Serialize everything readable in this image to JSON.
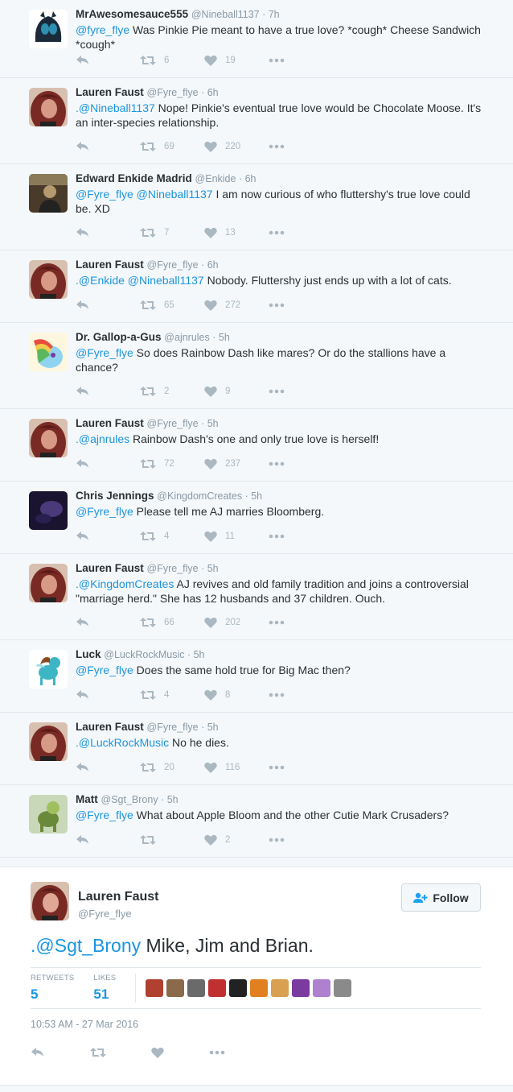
{
  "thread": [
    {
      "name": "MrAwesomesauce555",
      "handle": "@Nineball1137",
      "time": "7h",
      "mentions": "@fyre_flye",
      "text": " Was Pinkie Pie meant to have a true love? *cough* Cheese Sandwich *cough*",
      "retweets": "6",
      "likes": "19",
      "avatar_icon": "changeling-avatar",
      "avatar_colors": [
        "#1a2a3a",
        "#2e8fb0"
      ]
    },
    {
      "name": "Lauren Faust",
      "handle": "@Fyre_flye",
      "time": "6h",
      "mentions": ".@Nineball1137",
      "text": " Nope! Pinkie's eventual true love would be Chocolate Moose. It's an inter-species relationship.",
      "retweets": "69",
      "likes": "220",
      "avatar_icon": "lauren-avatar",
      "avatar_colors": [
        "#7a2a24",
        "#d69a86"
      ]
    },
    {
      "name": "Edward Enkide Madrid",
      "handle": "@Enkide",
      "time": "6h",
      "mentions": "@Fyre_flye @Nineball1137",
      "text": " I am now curious of who fluttershy's true love could be. XD",
      "retweets": "7",
      "likes": "13",
      "avatar_icon": "edward-avatar",
      "avatar_colors": [
        "#4a3a2a",
        "#b59a70"
      ]
    },
    {
      "name": "Lauren Faust",
      "handle": "@Fyre_flye",
      "time": "6h",
      "mentions": ".@Enkide @Nineball1137",
      "text": " Nobody. Fluttershy just ends up with a lot of cats.",
      "retweets": "65",
      "likes": "272",
      "avatar_icon": "lauren-avatar",
      "avatar_colors": [
        "#7a2a24",
        "#d69a86"
      ]
    },
    {
      "name": "Dr. Gallop-a-Gus",
      "handle": "@ajnrules",
      "time": "5h",
      "mentions": "@Fyre_flye",
      "text": " So does Rainbow Dash like mares? Or do the stallions have a chance?",
      "retweets": "2",
      "likes": "9",
      "avatar_icon": "rainbow-dash-avatar",
      "avatar_colors": [
        "#8fd3f0",
        "#f2c94c"
      ]
    },
    {
      "name": "Lauren Faust",
      "handle": "@Fyre_flye",
      "time": "5h",
      "mentions": ".@ajnrules",
      "text": " Rainbow Dash's one and only true love is herself!",
      "retweets": "72",
      "likes": "237",
      "avatar_icon": "lauren-avatar",
      "avatar_colors": [
        "#7a2a24",
        "#d69a86"
      ]
    },
    {
      "name": "Chris Jennings",
      "handle": "@KingdomCreates",
      "time": "5h",
      "mentions": "@Fyre_flye",
      "text": " Please tell me AJ marries Bloomberg.",
      "retweets": "4",
      "likes": "11",
      "avatar_icon": "chris-avatar",
      "avatar_colors": [
        "#1a1430",
        "#4a3a7a"
      ]
    },
    {
      "name": "Lauren Faust",
      "handle": "@Fyre_flye",
      "time": "5h",
      "mentions": ".@KingdomCreates",
      "text": " AJ revives and old family tradition and joins a controversial \"marriage herd.\" She has 12 husbands and 37 children. Ouch.",
      "retweets": "66",
      "likes": "202",
      "avatar_icon": "lauren-avatar",
      "avatar_colors": [
        "#7a2a24",
        "#d69a86"
      ]
    },
    {
      "name": "Luck",
      "handle": "@LuckRockMusic",
      "time": "5h",
      "mentions": "@Fyre_flye",
      "text": " Does the same hold true for Big Mac then?",
      "retweets": "4",
      "likes": "8",
      "avatar_icon": "pony-avatar",
      "avatar_colors": [
        "#ffffff",
        "#3cb5c4"
      ]
    },
    {
      "name": "Lauren Faust",
      "handle": "@Fyre_flye",
      "time": "5h",
      "mentions": ".@LuckRockMusic",
      "text": " No he dies.",
      "retweets": "20",
      "likes": "116",
      "avatar_icon": "lauren-avatar",
      "avatar_colors": [
        "#7a2a24",
        "#d69a86"
      ]
    },
    {
      "name": "Matt",
      "handle": "@Sgt_Brony",
      "time": "5h",
      "mentions": "@Fyre_flye",
      "text": " What about Apple Bloom and the other Cutie Mark Crusaders?",
      "retweets": "",
      "likes": "2",
      "avatar_icon": "matt-avatar",
      "avatar_colors": [
        "#6a8a3a",
        "#a0c060"
      ]
    }
  ],
  "main_tweet": {
    "name": "Lauren Faust",
    "handle": "@Fyre_flye",
    "follow_label": "Follow",
    "mention": ".@Sgt_Brony",
    "text": " Mike, Jim and Brian.",
    "retweets_label": "RETWEETS",
    "retweets": "5",
    "likes_label": "LIKES",
    "likes": "51",
    "timestamp": "10:53 AM - 27 Mar 2016",
    "liker_colors": [
      "#b04030",
      "#8a6a4a",
      "#6a6a6a",
      "#c03030",
      "#222222",
      "#e08020",
      "#d8a050",
      "#7a3aa0",
      "#b080d0",
      "#8a8a8a"
    ]
  },
  "colors": {
    "accent": "#1b95e0",
    "muted": "#8899a6",
    "icon": "#aab8c2"
  }
}
